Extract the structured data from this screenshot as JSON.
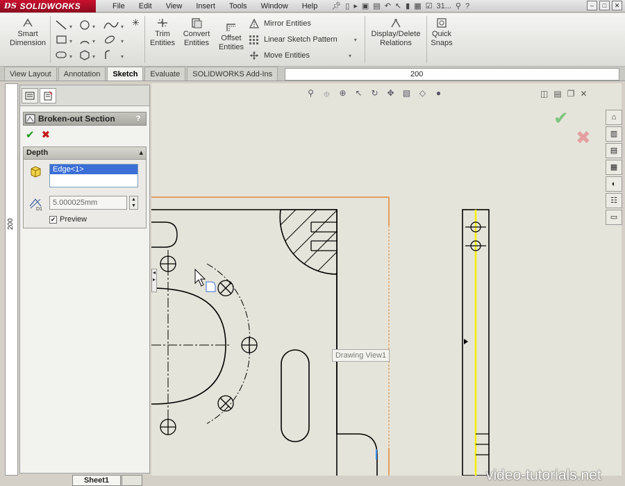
{
  "app": {
    "logo_prefix": "DS",
    "logo_text": "SOLIDWORKS",
    "menus": [
      "File",
      "Edit",
      "View",
      "Insert",
      "Tools",
      "Window",
      "Help"
    ],
    "title_suffix": "31...",
    "accent_color": "#c8102e"
  },
  "command_manager": {
    "smart_dimension": "Smart Dimension",
    "trim_entities": "Trim Entities",
    "convert_entities": "Convert Entities",
    "offset_entities": "Offset Entities",
    "mirror_entities": "Mirror Entities",
    "linear_sketch_pattern": "Linear Sketch Pattern",
    "move_entities": "Move Entities",
    "display_delete_relations": "Display/Delete Relations",
    "quick_snaps": "Quick Snaps"
  },
  "tabs": [
    {
      "label": "View Layout",
      "active": false
    },
    {
      "label": "Annotation",
      "active": false
    },
    {
      "label": "Sketch",
      "active": true
    },
    {
      "label": "Evaluate",
      "active": false
    },
    {
      "label": "SOLIDWORKS Add-Ins",
      "active": false
    }
  ],
  "rulers": {
    "top_value": "200",
    "left_value": "200"
  },
  "property_manager": {
    "title": "Broken-out Section",
    "help": "?",
    "group_title": "Depth",
    "selection_item": "Edge<1>",
    "depth_value": "5.000025mm",
    "depth_icon_label": "D1",
    "preview_label": "Preview",
    "preview_checked": true
  },
  "sheet": {
    "tab_label": "Sheet1"
  },
  "canvas": {
    "tooltip": "Drawing View1"
  },
  "watermark": "video-tutorials.net"
}
